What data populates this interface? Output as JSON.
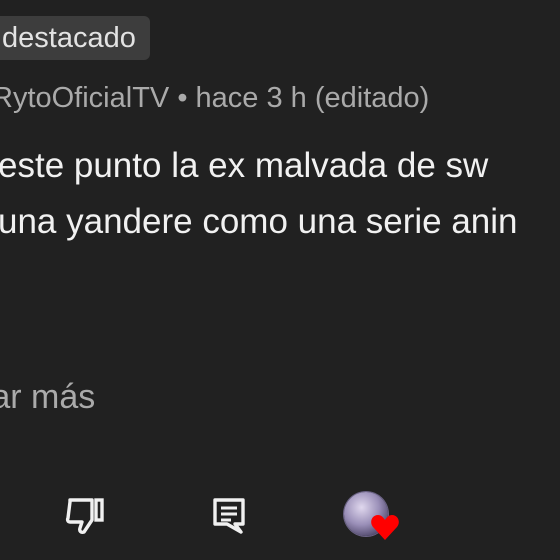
{
  "comment": {
    "pinned_label": "destacado",
    "author_meta": "RytoOficialTV • hace 3 h (editado)",
    "text_lines": [
      " este punto la ex malvada de sw",
      "una yandere como una serie anin"
    ],
    "read_more": "rar más"
  },
  "actions": [
    {
      "name": "dislike",
      "icon": "thumbs-down-icon"
    },
    {
      "name": "reply",
      "icon": "comment-icon"
    },
    {
      "name": "creator-heart",
      "icon": "heart-icon"
    }
  ],
  "colors": {
    "background": "#212121",
    "text_primary": "#f1f1f1",
    "text_secondary": "#aaaaaa",
    "badge_bg": "#3d3d3d",
    "heart": "#ff0000"
  }
}
